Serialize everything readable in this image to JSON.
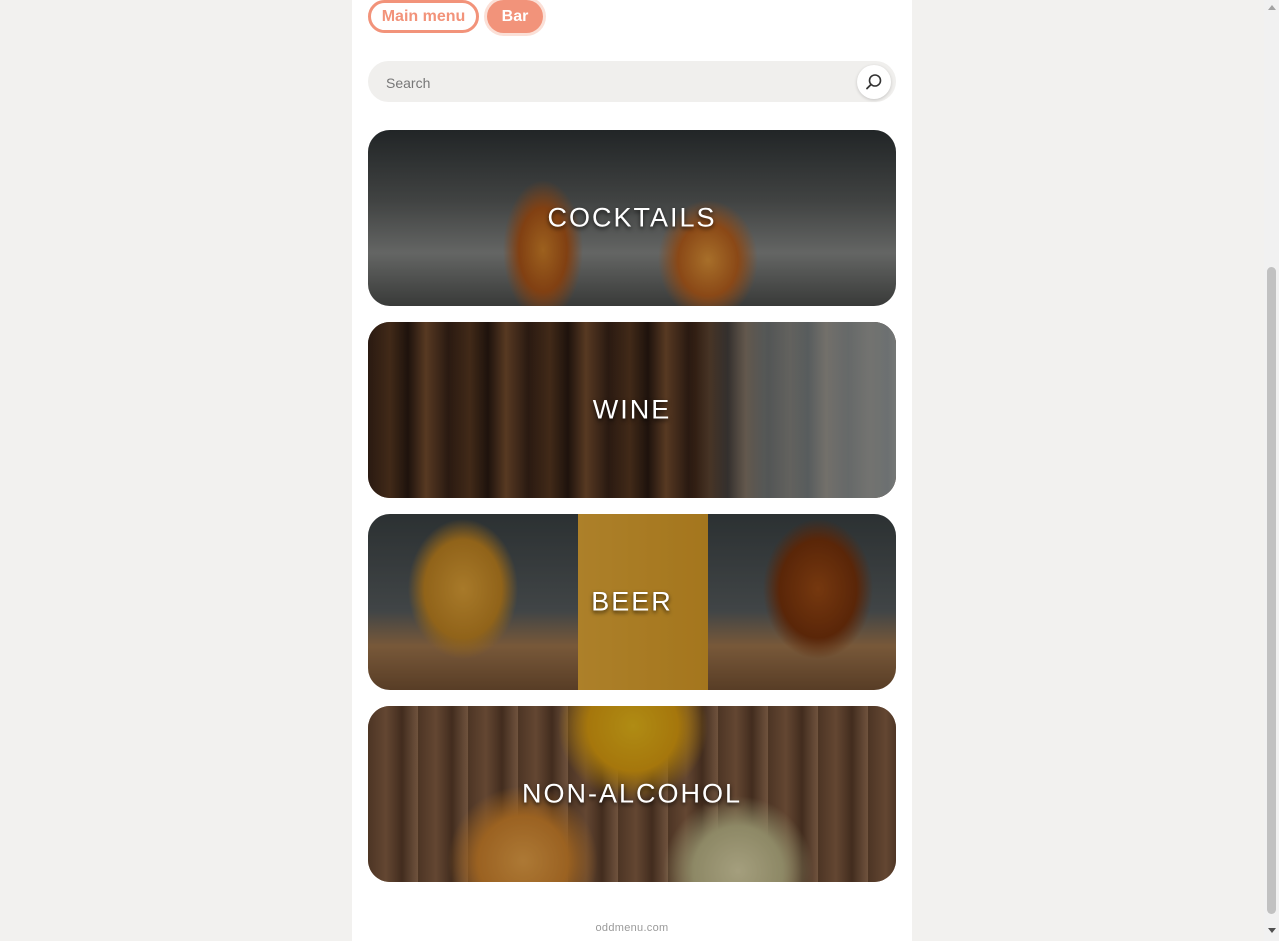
{
  "nav": {
    "main_menu_label": "Main menu",
    "bar_label": "Bar"
  },
  "search": {
    "placeholder": "Search",
    "icon": "search-icon"
  },
  "categories": [
    {
      "label": "COCKTAILS"
    },
    {
      "label": "WINE"
    },
    {
      "label": "BEER"
    },
    {
      "label": "NON-ALCOHOL"
    }
  ],
  "footer": {
    "text": "oddmenu.com"
  },
  "colors": {
    "accent": "#f2937a",
    "page_bg": "#f2f1ef"
  }
}
